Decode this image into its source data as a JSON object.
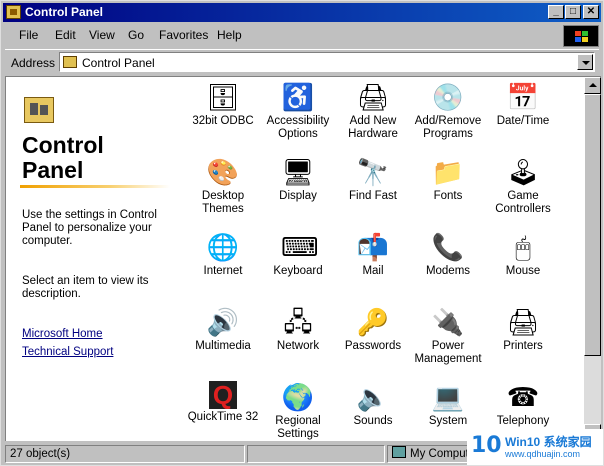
{
  "window": {
    "title": "Control Panel",
    "title_icon": "control-panel-icon"
  },
  "menu": [
    {
      "label": "File",
      "accel": "F"
    },
    {
      "label": "Edit",
      "accel": "E"
    },
    {
      "label": "View",
      "accel": "V"
    },
    {
      "label": "Go",
      "accel": "G"
    },
    {
      "label": "Favorites",
      "accel": "a"
    },
    {
      "label": "Help",
      "accel": "H"
    }
  ],
  "address": {
    "label": "Address",
    "value": "Control Panel"
  },
  "left_pane": {
    "title_line1": "Control",
    "title_line2": "Panel",
    "description": "Use the settings in Control Panel to personalize your computer.",
    "hint": "Select an item to view its description.",
    "links": [
      "Microsoft Home",
      "Technical Support"
    ]
  },
  "items": [
    {
      "name": "32bit ODBC",
      "icon": "odbc-icon",
      "glyph": "🗄"
    },
    {
      "name": "Accessibility Options",
      "icon": "accessibility-icon",
      "glyph": "♿"
    },
    {
      "name": "Add New Hardware",
      "icon": "add-hardware-icon",
      "glyph": "🖨"
    },
    {
      "name": "Add/Remove Programs",
      "icon": "add-remove-programs-icon",
      "glyph": "💿"
    },
    {
      "name": "Date/Time",
      "icon": "date-time-icon",
      "glyph": "📅"
    },
    {
      "name": "Desktop Themes",
      "icon": "desktop-themes-icon",
      "glyph": "🎨"
    },
    {
      "name": "Display",
      "icon": "display-icon",
      "glyph": "🖥"
    },
    {
      "name": "Find Fast",
      "icon": "find-fast-icon",
      "glyph": "🔭"
    },
    {
      "name": "Fonts",
      "icon": "fonts-icon",
      "glyph": "📁"
    },
    {
      "name": "Game Controllers",
      "icon": "game-controllers-icon",
      "glyph": "🕹"
    },
    {
      "name": "Internet",
      "icon": "internet-icon",
      "glyph": "🌐"
    },
    {
      "name": "Keyboard",
      "icon": "keyboard-icon",
      "glyph": "⌨"
    },
    {
      "name": "Mail",
      "icon": "mail-icon",
      "glyph": "📬"
    },
    {
      "name": "Modems",
      "icon": "modems-icon",
      "glyph": "📞"
    },
    {
      "name": "Mouse",
      "icon": "mouse-icon",
      "glyph": "🖱"
    },
    {
      "name": "Multimedia",
      "icon": "multimedia-icon",
      "glyph": "🔊"
    },
    {
      "name": "Network",
      "icon": "network-icon",
      "glyph": "🖧"
    },
    {
      "name": "Passwords",
      "icon": "passwords-icon",
      "glyph": "🔑"
    },
    {
      "name": "Power Management",
      "icon": "power-management-icon",
      "glyph": "🔌"
    },
    {
      "name": "Printers",
      "icon": "printers-icon",
      "glyph": "🖨"
    },
    {
      "name": "QuickTime 32",
      "icon": "quicktime-icon",
      "glyph": "Q"
    },
    {
      "name": "Regional Settings",
      "icon": "regional-settings-icon",
      "glyph": "🌍"
    },
    {
      "name": "Sounds",
      "icon": "sounds-icon",
      "glyph": "🔈"
    },
    {
      "name": "System",
      "icon": "system-icon",
      "glyph": "💻"
    },
    {
      "name": "Telephony",
      "icon": "telephony-icon",
      "glyph": "☎"
    }
  ],
  "status": {
    "count": "27 object(s)",
    "location": "My Computer"
  },
  "watermark": {
    "logo": "10",
    "main": "Win10 系统家园",
    "sub": "www.qdhuajin.com"
  }
}
